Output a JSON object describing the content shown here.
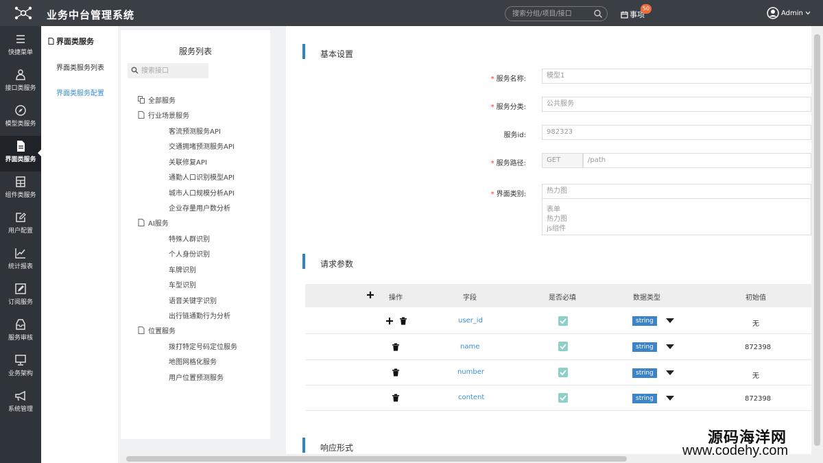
{
  "topbar": {
    "title": "业务中台管理系统",
    "search_placeholder": "搜索分组/项目/接口",
    "todo_label": "事项",
    "todo_count": "50",
    "user": "Admin"
  },
  "leftnav": [
    {
      "label": "快捷菜单",
      "icon": "menu-icon"
    },
    {
      "label": "接口类服务",
      "icon": "users-icon"
    },
    {
      "label": "模型类服务",
      "icon": "compass-icon"
    },
    {
      "label": "界面类服务",
      "icon": "document-icon",
      "active": true
    },
    {
      "label": "组件类服务",
      "icon": "calculator-icon"
    },
    {
      "label": "用户配置",
      "icon": "edit-icon"
    },
    {
      "label": "统计报表",
      "icon": "chart-icon"
    },
    {
      "label": "订阅服务",
      "icon": "pencil-square-icon"
    },
    {
      "label": "服务审核",
      "icon": "inbox-icon"
    },
    {
      "label": "业务架构",
      "icon": "monitor-icon"
    },
    {
      "label": "系统管理",
      "icon": "megaphone-icon"
    }
  ],
  "subnav": {
    "header": "界面类服务",
    "items": [
      {
        "label": "界面类服务列表"
      },
      {
        "label": "界面类服务配置",
        "active": true
      }
    ]
  },
  "services": {
    "title": "服务列表",
    "search_placeholder": "搜索接口",
    "all": "全部服务",
    "groups": [
      {
        "name": "行业场景服务",
        "items": [
          "客流预测服务API",
          "交通拥堵预测服务API",
          "关联修复API",
          "通勤人口识别模型API",
          "城市人口规模分析API",
          "企业存量用户数分析"
        ]
      },
      {
        "name": "AI服务",
        "items": [
          "特殊人群识别",
          "个人身份识别",
          "车牌识别",
          "车型识别",
          "语音关键字识别",
          "出行链通勤行为分析"
        ]
      },
      {
        "name": "位置服务",
        "items": [
          "拨打特定号码定位服务",
          "地图网格化服务",
          "用户位置预测服务"
        ]
      }
    ]
  },
  "basic": {
    "title": "基本设置",
    "name_label": "服务名称:",
    "name_value": "模型1",
    "category_label": "服务分类:",
    "category_value": "公共服务",
    "id_label": "服务id:",
    "id_value": "982323",
    "path_label": "服务路径:",
    "path_method": "GET",
    "path_value": "/path",
    "ui_label": "界面类别:",
    "ui_value": "热力图",
    "ui_options": [
      "表单",
      "热力图",
      "js组件"
    ]
  },
  "params": {
    "title": "请求参数",
    "headers": [
      "操作",
      "字段",
      "是否必填",
      "数据类型",
      "初始值"
    ],
    "rows": [
      {
        "field": "user_id",
        "type": "string",
        "init": "无"
      },
      {
        "field": "name",
        "type": "string",
        "init": "872398"
      },
      {
        "field": "number",
        "type": "string",
        "init": "无"
      },
      {
        "field": "content",
        "type": "string",
        "init": "872398"
      }
    ]
  },
  "response": {
    "title": "响应形式"
  },
  "watermark": {
    "cn": "源码海洋网",
    "en": "www.codehy.com"
  }
}
